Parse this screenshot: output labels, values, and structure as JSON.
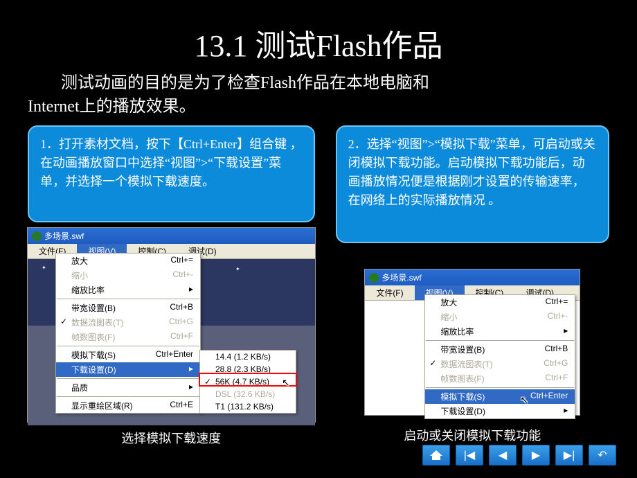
{
  "title": "13.1  测试Flash作品",
  "intro_line1_indent": "        测试动画的目的是为了检查Flash作品在本地电脑和",
  "intro_line2": "Internet上的播放效果。",
  "callout1": "1．打开素材文档，按下【Ctrl+Enter】组合键 ，在动画播放窗口中选择“视图”>“下载设置”菜单，并选择一个模拟下载速度。",
  "callout2": "2．选择“视图”>“模拟下载”菜单，可启动或关闭模拟下载功能。启动模拟下载功能后，动画播放情况便是根据刚才设置的传输速率，在网络上的实际播放情况 。",
  "swf_title": "多场景.swf",
  "menubar": {
    "file": "文件(F)",
    "view": "视图(V)",
    "control": "控制(C)",
    "debug": "调试(D)"
  },
  "view_menu": {
    "zoom_in": {
      "label": "放大",
      "shortcut": "Ctrl+="
    },
    "zoom_out": {
      "label": "缩小",
      "shortcut": "Ctrl+-"
    },
    "scale": {
      "label": "缩放比率"
    },
    "bandwidth": {
      "label": "带宽设置(B)",
      "shortcut": "Ctrl+B"
    },
    "stream_graph": {
      "label": "数据流图表(T)",
      "shortcut": "Ctrl+G"
    },
    "frame_graph": {
      "label": "帧数图表(F)",
      "shortcut": "Ctrl+F"
    },
    "simulate": {
      "label": "模拟下载(S)",
      "shortcut": "Ctrl+Enter"
    },
    "download_settings": {
      "label": "下载设置(D)"
    },
    "quality": {
      "label": "品质"
    },
    "redraw": {
      "label": "显示重绘区域(R)",
      "shortcut": "Ctrl+E"
    }
  },
  "download_speeds": {
    "s1": "14.4 (1.2 KB/s)",
    "s2": "28.8 (2.3 KB/s)",
    "s3": "56K (4.7 KB/s)",
    "s4": "DSL (32.6 KB/s)",
    "s5": "T1 (131.2 KB/s)"
  },
  "caption_left": "选择模拟下载速度",
  "caption_right": "启动或关闭模拟下载功能",
  "nav": {
    "home": "home",
    "first": "first",
    "prev": "prev",
    "next": "next",
    "last": "last",
    "return": "return"
  }
}
